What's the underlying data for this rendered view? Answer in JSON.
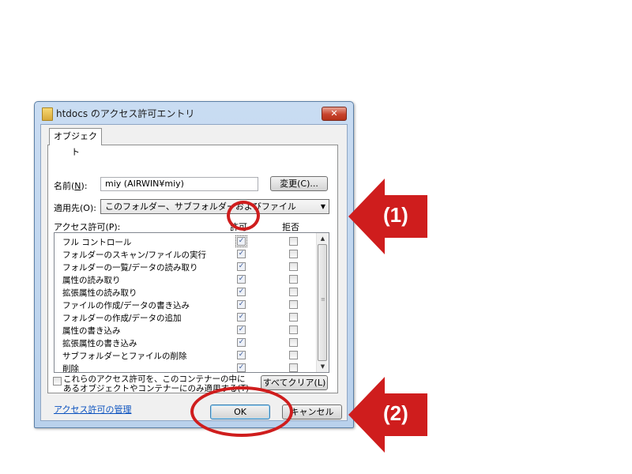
{
  "window": {
    "title": "htdocs のアクセス許可エントリ",
    "close_label": "✕"
  },
  "tab": {
    "label": "オブジェクト"
  },
  "name_field": {
    "label_prefix": "名前(",
    "label_key": "N",
    "label_suffix": "):",
    "value": "miy (AIRWIN¥miy)",
    "change_button": "変更(C)..."
  },
  "apply_to": {
    "label": "適用先(O):",
    "selected": "このフォルダー、サブフォルダーおよびファイル"
  },
  "permissions": {
    "label": "アクセス許可(P):",
    "col_allow": "許可",
    "col_deny": "拒否",
    "rows": [
      {
        "name": "フル コントロール",
        "allow": true,
        "deny": false
      },
      {
        "name": "フォルダーのスキャン/ファイルの実行",
        "allow": true,
        "deny": false
      },
      {
        "name": "フォルダーの一覧/データの読み取り",
        "allow": true,
        "deny": false
      },
      {
        "name": "属性の読み取り",
        "allow": true,
        "deny": false
      },
      {
        "name": "拡張属性の読み取り",
        "allow": true,
        "deny": false
      },
      {
        "name": "ファイルの作成/データの書き込み",
        "allow": true,
        "deny": false
      },
      {
        "name": "フォルダーの作成/データの追加",
        "allow": true,
        "deny": false
      },
      {
        "name": "属性の書き込み",
        "allow": true,
        "deny": false
      },
      {
        "name": "拡張属性の書き込み",
        "allow": true,
        "deny": false
      },
      {
        "name": "サブフォルダーとファイルの削除",
        "allow": true,
        "deny": false
      },
      {
        "name": "削除",
        "allow": true,
        "deny": false
      }
    ]
  },
  "inherit_checkbox": {
    "checked": false,
    "label": "これらのアクセス許可を、このコンテナーの中にあるオブジェクトやコンテナーにのみ適用する(T)"
  },
  "clear_all_button": "すべてクリア(L)",
  "manage_link": "アクセス許可の管理",
  "ok_button": "OK",
  "cancel_button": "キャンセル",
  "annotations": {
    "label_1": "(1)",
    "label_2": "(2)",
    "color": "#cf1d1d"
  }
}
